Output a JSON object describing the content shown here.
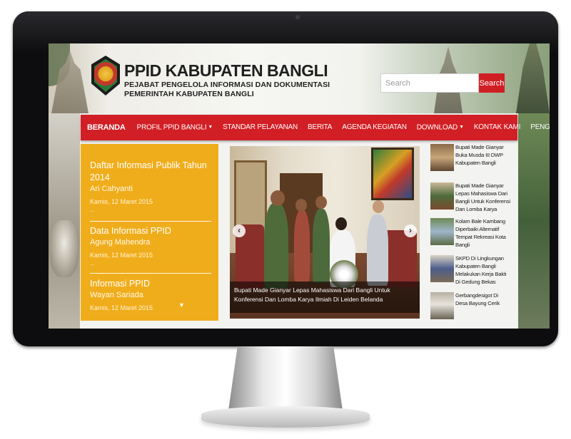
{
  "header": {
    "site_title": "PPID KABUPATEN BANGLI",
    "subtitle_line1": "PEJABAT PENGELOLA INFORMASI DAN DOKUMENTASI",
    "subtitle_line2": "PEMERINTAH KABUPATEN BANGLI",
    "search": {
      "placeholder": "Search",
      "button_label": "Search"
    }
  },
  "nav": {
    "items": [
      {
        "label": "BERANDA",
        "active": true
      },
      {
        "label": "PROFIL PPID BANGLI",
        "dropdown": true
      },
      {
        "label": "STANDAR PELAYANAN"
      },
      {
        "label": "BERITA"
      },
      {
        "label": "AGENDA KEGIATAN"
      },
      {
        "label": "DOWNLOAD",
        "dropdown": true
      },
      {
        "label": "KONTAK KAMI"
      },
      {
        "label": "PENGADUAN ONLINE"
      }
    ],
    "color": "#d11f25"
  },
  "info_panel": {
    "color": "#f0ad1b",
    "items": [
      {
        "title": "Daftar Informasi Publik Tahun 2014",
        "author": "Ari Cahyanti",
        "date": "Kamis, 12 Maret 2015",
        "more": "..."
      },
      {
        "title": "Data Informasi PPID",
        "author": "Agung Mahendra",
        "date": "Kamis, 12 Maret 2015",
        "more": "..."
      },
      {
        "title": "Informasi PPID",
        "author": "Wayan Sariada",
        "date": "Kamis, 12 Maret 2015"
      }
    ],
    "scroll_icon": "chevron-down-icon"
  },
  "slider": {
    "caption": "Bupati Made Gianyar Lepas Mahasiswa Dari Bangli Untuk Konferensi Dan Lomba Karya Ilmiah Di Leiden Belanda",
    "prev_icon": "‹",
    "next_icon": "›"
  },
  "news": [
    {
      "title": "Bupati Made Gianyar Buka Musda III DWP Kabupaten Bangli"
    },
    {
      "title": "Bupati Made Gianyar Lepas Mahasiswa Dari Bangli Untuk Konferensi Dan Lomba Karya Ilmiah Di Leiden Belanda"
    },
    {
      "title": "Kolam Bale Kambang Diperbaiki Alternatif Tempat Rekreasi Kota Bangli"
    },
    {
      "title": "SKPD Di Lingkungan Kabupaten Bangli Melakukan Kerja Bakti Di Gedung Bekas Rumah Sakit Umum Bangli"
    },
    {
      "title": "Gerbangdesigot Di Desa Bayung Cerik"
    }
  ]
}
